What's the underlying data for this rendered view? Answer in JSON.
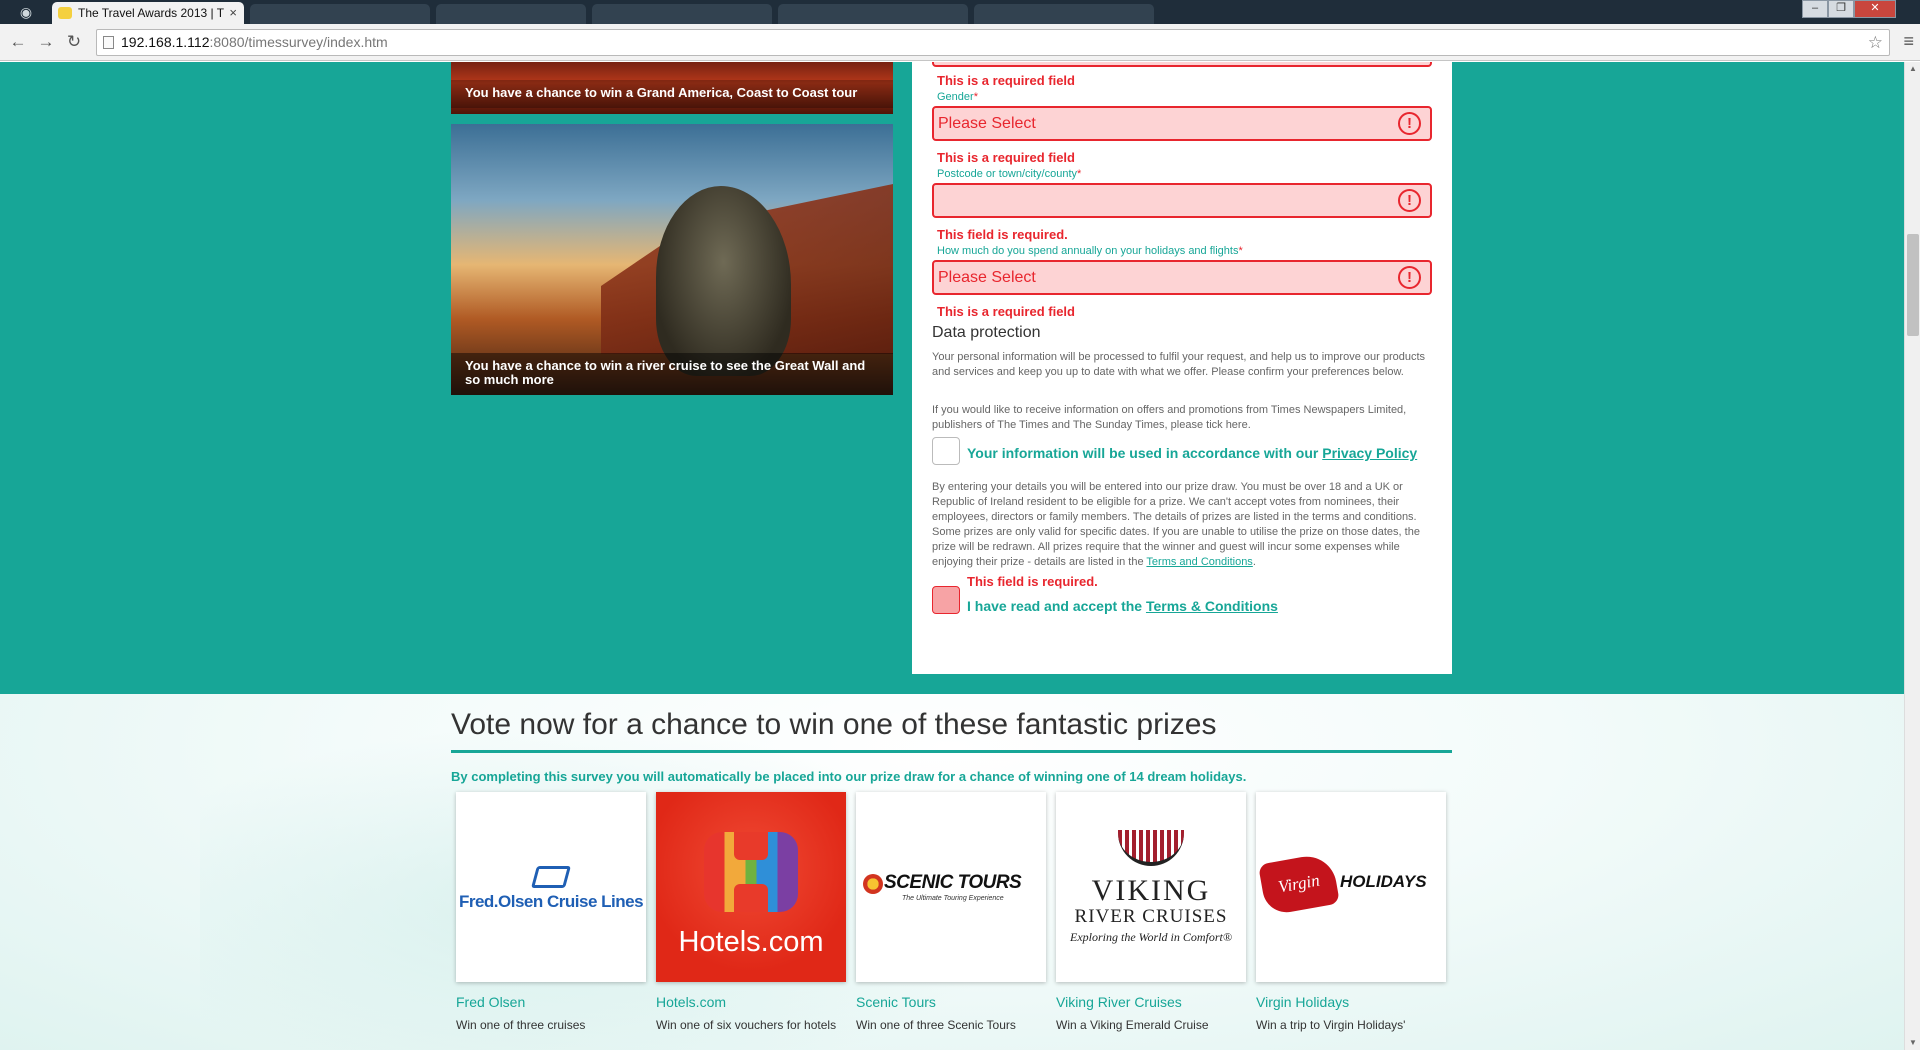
{
  "browser": {
    "tab_title": "The Travel Awards 2013 | T",
    "tab_close": "×",
    "url_host": "192.168.1.112",
    "url_rest": ":8080/timessurvey/index.htm",
    "back": "←",
    "forward": "→",
    "reload": "↻",
    "star": "☆",
    "menu": "≡",
    "window_buttons": [
      "–",
      "❐",
      "✕"
    ]
  },
  "promos": [
    {
      "caption": "You have a chance to win a Grand America, Coast to Coast tour"
    },
    {
      "caption": "You have a chance to win a river cruise to see the Great Wall and so much more"
    }
  ],
  "form": {
    "top_error": "This is a required field",
    "gender": {
      "label": "Gender",
      "required_mark": "*",
      "value": "Please Select",
      "error": "This is a required field"
    },
    "postcode": {
      "label": "Postcode or town/city/county",
      "required_mark": "*",
      "value": "",
      "error": "This field is required."
    },
    "spend": {
      "label": "How much do you spend annually on your holidays and flights",
      "required_mark": "*",
      "value": "Please Select",
      "error": "This is a required field"
    },
    "alert_glyph": "!",
    "data_protection": {
      "heading": "Data protection",
      "para1": "Your personal information will be processed to fulfil your request, and help us to improve our products and services and keep you up to date with what we offer. Please confirm your preferences below.",
      "para2": "If you would like to receive information on offers and promotions from Times Newspapers Limited, publishers of The Times and The Sunday Times, please tick here.",
      "privacy_label": "Your information will be used in accordance with our ",
      "privacy_link": "Privacy Policy",
      "terms_para": "By entering your details you will be entered into our prize draw. You must be over 18 and a UK or Republic of Ireland resident to be eligible for a prize. We can't accept votes from nominees, their employees, directors or family members. The details of prizes are listed in the terms and conditions. Some prizes are only valid for specific dates. If you are unable to utilise the prize on those dates, the prize will be redrawn. All prizes require that the winner and guest will incur some expenses while enjoying their prize - details are listed in the ",
      "terms_para_link": "Terms and Conditions",
      "terms_para_end": ".",
      "terms_error": "This field is required.",
      "accept_label": "I have read and accept the ",
      "accept_link": "Terms & Conditions"
    }
  },
  "prizes_section": {
    "heading": "Vote now for a chance to win one of these fantastic prizes",
    "intro": "By completing this survey you will automatically be placed into our prize draw for a chance of winning one of 14 dream holidays.",
    "prizes": [
      {
        "name": "Fred Olsen",
        "desc": "Win one of three cruises",
        "logo_text": "Fred.Olsen Cruise Lines"
      },
      {
        "name": "Hotels.com",
        "desc": "Win one of six vouchers for hotels",
        "logo_text": "Hotels.com"
      },
      {
        "name": "Scenic Tours",
        "desc": "Win one of three Scenic Tours",
        "logo_text": "SCENIC TOURS",
        "logo_sub": "The Ultimate Touring Experience"
      },
      {
        "name": "Viking River Cruises",
        "desc": "Win a Viking Emerald Cruise",
        "logo_text": "VIKING",
        "logo_text2": "RIVER CRUISES",
        "logo_sub": "Exploring the World in Comfort®"
      },
      {
        "name": "Virgin Holidays",
        "desc": "Win a trip to Virgin Holidays'",
        "logo_badge": "Virgin",
        "logo_text": "HOLIDAYS"
      }
    ]
  },
  "colors": {
    "teal": "#17a697",
    "error_red": "#e8262e",
    "error_bg": "#fdd3d4"
  }
}
